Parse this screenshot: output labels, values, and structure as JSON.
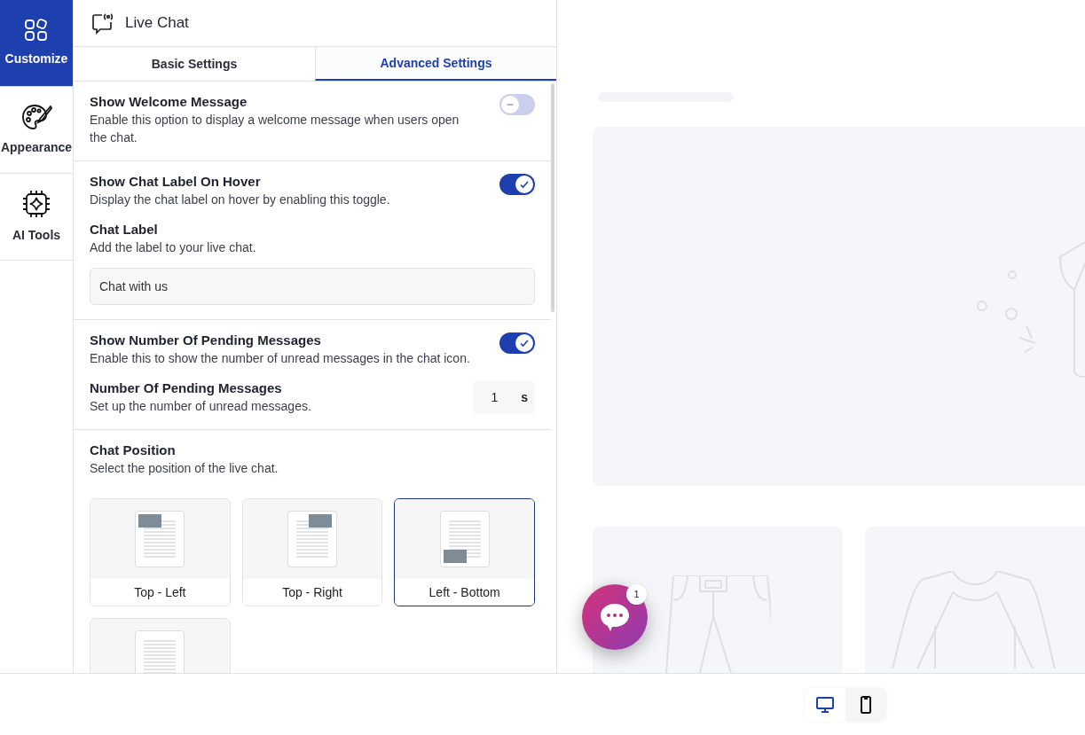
{
  "sidebar": {
    "items": [
      {
        "label": "Customize",
        "selected": true
      },
      {
        "label": "Appearance",
        "selected": false
      },
      {
        "label": "AI Tools",
        "selected": false
      }
    ]
  },
  "panel": {
    "title": "Live Chat",
    "tabs": [
      {
        "label": "Basic Settings",
        "selected": false
      },
      {
        "label": "Advanced Settings",
        "selected": true
      }
    ],
    "sections": [
      {
        "rows": [
          {
            "kind": "toggle",
            "title": "Show Welcome Message",
            "description": "Enable this option to display a welcome message when users open the chat.",
            "on": false
          }
        ]
      },
      {
        "rows": [
          {
            "kind": "toggle",
            "title": "Show Chat Label On Hover",
            "description": "Display the chat label on hover by enabling this toggle.",
            "on": true
          },
          {
            "kind": "text",
            "title": "Chat Label",
            "description": "Add the label to your live chat.",
            "value": "Chat with us"
          }
        ]
      },
      {
        "rows": [
          {
            "kind": "toggle",
            "title": "Show Number Of Pending Messages",
            "description": "Enable this to show the number of unread messages in the chat icon.",
            "on": true
          },
          {
            "kind": "number",
            "title": "Number Of Pending Messages",
            "description": "Set up the number of unread messages.",
            "value": "1",
            "unit": "s"
          }
        ]
      },
      {
        "rows": [
          {
            "kind": "positions",
            "title": "Chat Position",
            "description": "Select the position of the live chat.",
            "options": [
              {
                "label": "Top - Left",
                "kind": "top-left",
                "selected": false
              },
              {
                "label": "Top - Right",
                "kind": "top-right",
                "selected": false
              },
              {
                "label": "Left - Bottom",
                "kind": "bottom-left",
                "selected": true
              },
              {
                "selected": false
              }
            ]
          }
        ]
      }
    ]
  },
  "preview": {
    "chat_badge": "1"
  },
  "devices": [
    {
      "kind": "desktop",
      "selected": true
    },
    {
      "kind": "mobile",
      "selected": false
    }
  ]
}
